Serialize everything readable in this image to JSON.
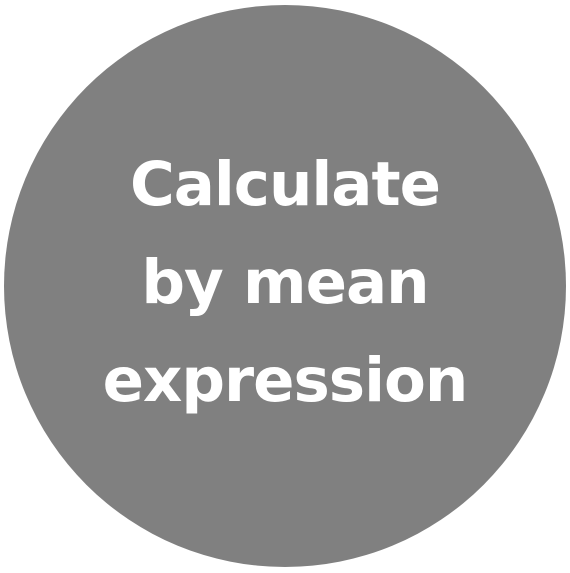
{
  "shape": {
    "fill_color": "#808080",
    "text_color": "#ffffff"
  },
  "label": {
    "lines": [
      "Calculate",
      "by mean",
      "expression"
    ]
  }
}
